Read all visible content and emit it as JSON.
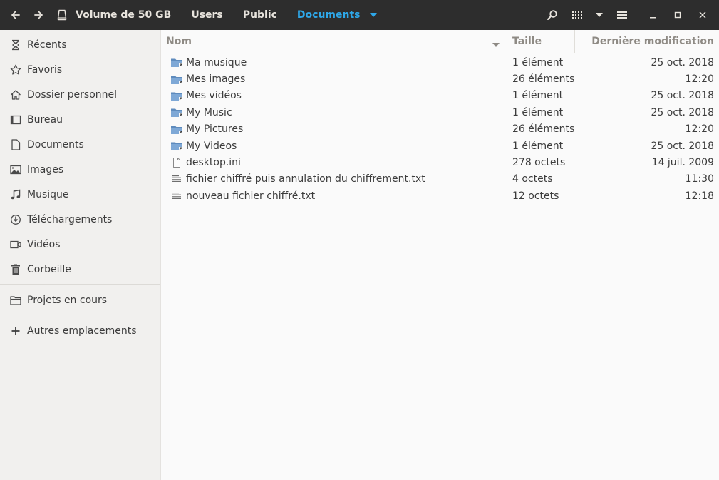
{
  "header": {
    "breadcrumbs": [
      "Volume de 50 GB",
      "Users",
      "Public",
      "Documents"
    ],
    "active_color": "#2ea7e8",
    "icons": [
      "back-arrow-icon",
      "forward-arrow-icon",
      "drive-icon",
      "dropdown-caret-icon",
      "search-icon",
      "grid-view-icon",
      "view-options-caret-icon",
      "hamburger-menu-icon",
      "minimize-icon",
      "maximize-icon",
      "close-icon"
    ]
  },
  "sidebar": {
    "items": [
      {
        "label": "Récents",
        "icon": "hourglass-icon"
      },
      {
        "label": "Favoris",
        "icon": "star-icon"
      },
      {
        "label": "Dossier personnel",
        "icon": "home-icon"
      },
      {
        "label": "Bureau",
        "icon": "desktop-icon"
      },
      {
        "label": "Documents",
        "icon": "document-icon"
      },
      {
        "label": "Images",
        "icon": "image-icon"
      },
      {
        "label": "Musique",
        "icon": "music-icon"
      },
      {
        "label": "Téléchargements",
        "icon": "download-icon"
      },
      {
        "label": "Vidéos",
        "icon": "video-icon"
      },
      {
        "label": "Corbeille",
        "icon": "trash-icon"
      }
    ],
    "bookmarks": [
      {
        "label": "Projets en cours",
        "icon": "folder-icon"
      }
    ],
    "other": {
      "label": "Autres emplacements",
      "icon": "plus-icon"
    }
  },
  "columns": {
    "name": "Nom",
    "size": "Taille",
    "modified": "Dernière modification"
  },
  "files": [
    {
      "name": "Ma musique",
      "size": "1 élément",
      "modified": "25 oct. 2018",
      "type": "folder-link"
    },
    {
      "name": "Mes images",
      "size": "26 éléments",
      "modified": "12:20",
      "type": "folder-link"
    },
    {
      "name": "Mes vidéos",
      "size": "1 élément",
      "modified": "25 oct. 2018",
      "type": "folder-link"
    },
    {
      "name": "My Music",
      "size": "1 élément",
      "modified": "25 oct. 2018",
      "type": "folder-link"
    },
    {
      "name": "My Pictures",
      "size": "26 éléments",
      "modified": "12:20",
      "type": "folder-link"
    },
    {
      "name": "My Videos",
      "size": "1 élément",
      "modified": "25 oct. 2018",
      "type": "folder-link"
    },
    {
      "name": "desktop.ini",
      "size": "278 octets",
      "modified": "14 juil. 2009",
      "type": "file"
    },
    {
      "name": "fichier chiffré puis annulation du chiffrement.txt",
      "size": "4 octets",
      "modified": "11:30",
      "type": "text"
    },
    {
      "name": "nouveau fichier chiffré.txt",
      "size": "12 octets",
      "modified": "12:18",
      "type": "text"
    }
  ]
}
